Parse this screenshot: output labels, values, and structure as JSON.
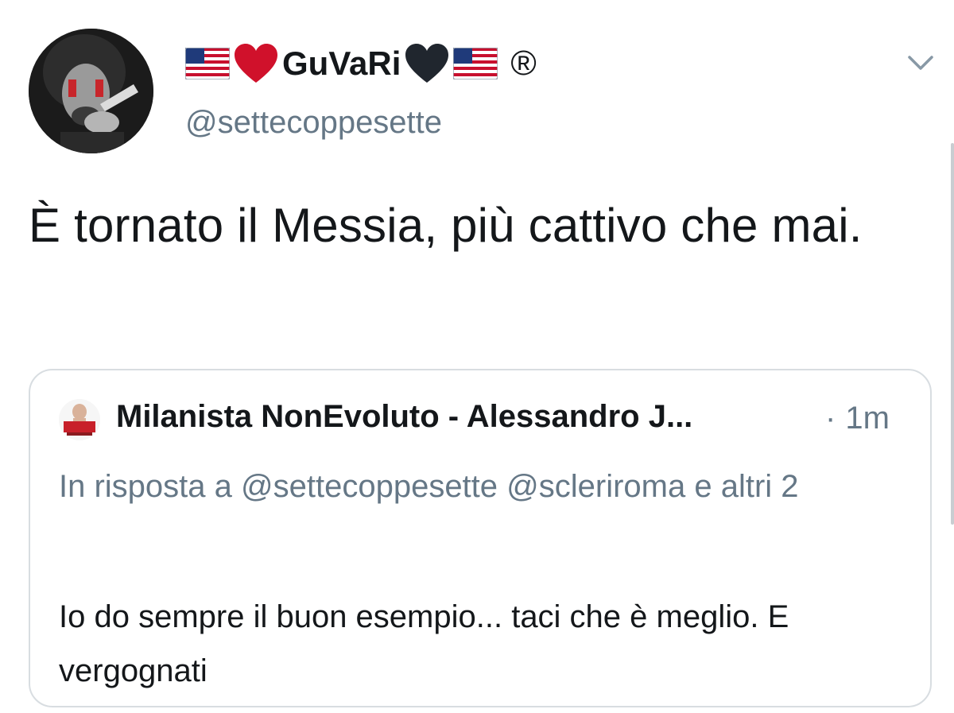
{
  "header": {
    "display_name": "GuVaRi",
    "registered_mark": "®",
    "handle": "@settecoppesette"
  },
  "icons": {
    "flag": "us-flag-emoji",
    "red_heart": "red-heart-emoji",
    "black_heart": "black-heart-emoji",
    "caret": "chevron-down-icon"
  },
  "tweet": {
    "text": "È tornato il Messia, più cattivo che mai."
  },
  "quoted": {
    "author": "Milanista NonEvoluto - Alessandro J...",
    "time_separator": "·",
    "time": "1m",
    "reply_context": "In risposta a @settecoppesette @scleriroma e altri 2",
    "text": "Io do sempre il buon esempio... taci che è meglio. E vergognati"
  },
  "colors": {
    "text_primary": "#14171a",
    "text_secondary": "#657786",
    "border": "#d8dde1",
    "heart_red": "#d0112b",
    "heart_black": "#20262e"
  }
}
